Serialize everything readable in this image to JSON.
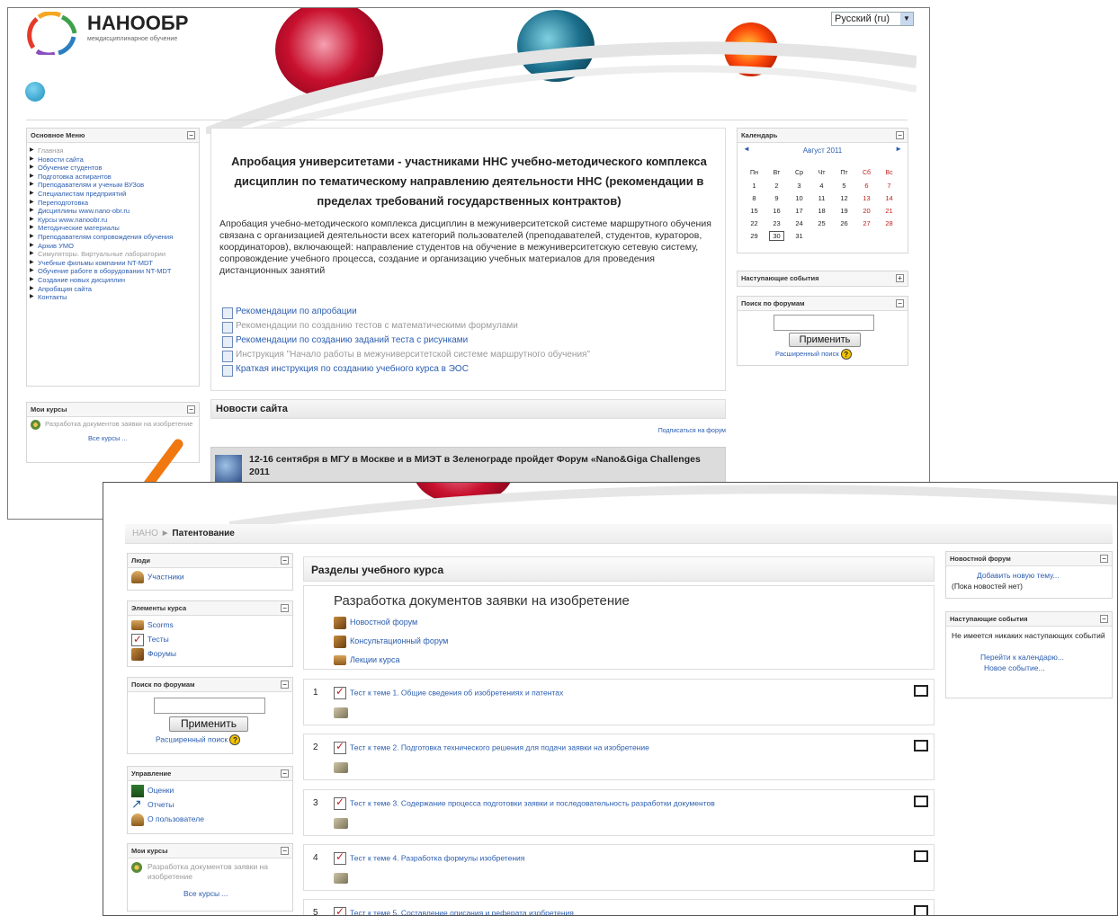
{
  "screen1": {
    "brand": "НАНООБР",
    "brand_sub": "междисциплинарное обучение",
    "language": "Русский (ru)",
    "main_menu": {
      "title": "Основное Меню",
      "items": [
        {
          "label": "Главная",
          "muted": true
        },
        {
          "label": "Новости сайта",
          "muted": false
        },
        {
          "label": "Обучение студентов",
          "muted": false
        },
        {
          "label": "Подготовка аспирантов",
          "muted": false
        },
        {
          "label": "Преподавателям и ученым ВУЗов",
          "muted": false
        },
        {
          "label": "Специалистам предприятий",
          "muted": false
        },
        {
          "label": "Переподготовка",
          "muted": false
        },
        {
          "label": "Дисциплины www.nano-obr.ru",
          "muted": false
        },
        {
          "label": "Курсы www.nanoobr.ru",
          "muted": false
        },
        {
          "label": "Методические материалы",
          "muted": false
        },
        {
          "label": "Преподавателям сопровождения обучения",
          "muted": false
        },
        {
          "label": "Архив УМО",
          "muted": false
        },
        {
          "label": "Симуляторы. Виртуальные лаборатории",
          "muted": true
        },
        {
          "label": "Учебные фильмы компании NT-MDT",
          "muted": false
        },
        {
          "label": "Обучение работе в оборудовании NT-MDT",
          "muted": false
        },
        {
          "label": "Создание новых дисциплин",
          "muted": false
        },
        {
          "label": "Апробация сайта",
          "muted": false
        },
        {
          "label": "Контакты",
          "muted": false
        }
      ]
    },
    "my_courses": {
      "title": "Мои курсы",
      "course": "Разработка документов заявки на изобретение",
      "all": "Все курсы ..."
    },
    "main": {
      "title": "Апробация университетами - участниками ННС учебно-методического комплекса дисциплин по тематическому направлению деятельности ННС (рекомендации в пределах требований государственных контрактов)",
      "description": "Апробация учебно-методического комплекса дисциплин в межуниверситетской системе маршрутного обучения связана с организацией деятельности всех категорий пользователей (преподавателей, студентов, кураторов, координаторов), включающей: направление студентов на обучение в межуниверситетскую сетевую систему, сопровождение учебного процесса, создание и организацию учебных материалов для проведения дистанционных занятий",
      "links": [
        {
          "label": "Рекомендации по апробации",
          "muted": false
        },
        {
          "label": "Рекомендации по созданию тестов с математическими формулами",
          "muted": true
        },
        {
          "label": "Рекомендации по созданию заданий теста с рисунками",
          "muted": false
        },
        {
          "label": "Инструкция \"Начало работы в межуниверситетской системе маршрутного обучения\"",
          "muted": true
        },
        {
          "label": "Краткая инструкция по созданию учебного курса в ЭОС",
          "muted": false
        }
      ]
    },
    "news": {
      "title": "Новости сайта",
      "subscribe": "Подписаться на форум",
      "item": "12-16 сентября в МГУ в Москве и в МИЭТ в Зеленограде пройдет Форум «Nano&Giga Challenges 2011"
    },
    "calendar": {
      "title": "Календарь",
      "month": "Август 2011",
      "prev": "◄",
      "next": "►",
      "days": [
        "Пн",
        "Вт",
        "Ср",
        "Чт",
        "Пт",
        "Сб",
        "Вс"
      ],
      "weeks": [
        [
          "1",
          "2",
          "3",
          "4",
          "5",
          "6",
          "7"
        ],
        [
          "8",
          "9",
          "10",
          "11",
          "12",
          "13",
          "14"
        ],
        [
          "15",
          "16",
          "17",
          "18",
          "19",
          "20",
          "21"
        ],
        [
          "22",
          "23",
          "24",
          "25",
          "26",
          "27",
          "28"
        ],
        [
          "29",
          "30",
          "31",
          "",
          "",
          "",
          ""
        ]
      ],
      "today": "30"
    },
    "upcoming": {
      "title": "Наступающие события"
    },
    "forum_search": {
      "title": "Поиск по форумам",
      "button": "Применить",
      "advanced": "Расширенный поиск",
      "help": "?"
    }
  },
  "screen2": {
    "breadcrumb": {
      "home": "НАНО",
      "sep": "►",
      "current": "Патентование"
    },
    "people": {
      "title": "Люди",
      "items": [
        "Участники"
      ]
    },
    "course_elements": {
      "title": "Элементы курса",
      "items": [
        "Scorms",
        "Тесты",
        "Форумы"
      ]
    },
    "forum_search": {
      "title": "Поиск по форумам",
      "button": "Применить",
      "advanced": "Расширенный поиск",
      "help": "?"
    },
    "admin": {
      "title": "Управление",
      "items": [
        "Оценки",
        "Отчеты",
        "О пользователе"
      ]
    },
    "my_courses": {
      "title": "Мои курсы",
      "course": "Разработка документов заявки на изобретение",
      "all": "Все курсы ..."
    },
    "sections_title": "Разделы учебного курса",
    "topic0": {
      "title": "Разработка документов заявки на изобретение",
      "items": [
        "Новостной форум",
        "Консультационный форум",
        "Лекции курса"
      ]
    },
    "topics": [
      {
        "num": "1",
        "label": "Тест к теме 1. Общие сведения об изобретениях и патентах"
      },
      {
        "num": "2",
        "label": "Тест к теме 2. Подготовка технического решения для подачи заявки на изобретение"
      },
      {
        "num": "3",
        "label": "Тест к теме 3. Содержание процесса подготовки заявки и последовательность разработки документов"
      },
      {
        "num": "4",
        "label": "Тест к теме 4. Разработка формулы изобретения"
      },
      {
        "num": "5",
        "label": "Тест к теме 5. Составление описания и реферата изобретения"
      }
    ],
    "news_forum": {
      "title": "Новостной форум",
      "add": "Добавить новую тему...",
      "none": "(Пока новостей нет)"
    },
    "upcoming": {
      "title": "Наступающие события",
      "none": "Не имеется никаких наступающих событий",
      "goto": "Перейти к календарю...",
      "new": "Новое событие..."
    }
  },
  "colors": {
    "link": "#2a5db0",
    "arrow": "#f0780f",
    "weekend": "#c0201c"
  }
}
